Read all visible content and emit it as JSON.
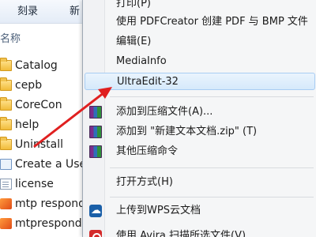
{
  "explorer": {
    "toolbar": {
      "burn_label": "刻录",
      "new_label": "新"
    },
    "column_header": "名称",
    "files": [
      {
        "name": "Catalog",
        "icon": "folder-icon"
      },
      {
        "name": "cepb",
        "icon": "folder-icon"
      },
      {
        "name": "CoreCon",
        "icon": "folder-icon"
      },
      {
        "name": "help",
        "icon": "folder-icon"
      },
      {
        "name": "Uninstall",
        "icon": "folder-icon"
      },
      {
        "name": "Create a User",
        "icon": "shortcut-icon"
      },
      {
        "name": "license",
        "icon": "doc-icon"
      },
      {
        "name": "mtp respond",
        "icon": "app-icon"
      },
      {
        "name": "mtprespond",
        "icon": "app-icon"
      }
    ]
  },
  "context_menu": {
    "items": [
      {
        "label": "打印(P)",
        "icon": ""
      },
      {
        "label": "使用 PDFCreator 创建 PDF 与 BMP 文件",
        "icon": ""
      },
      {
        "label": "编辑(E)",
        "icon": ""
      },
      {
        "label": "MediaInfo",
        "icon": ""
      },
      {
        "label": "UltraEdit-32",
        "icon": "",
        "highlighted": true
      },
      {
        "label": "添加到压缩文件(A)...",
        "icon": "rar-icon"
      },
      {
        "label": "添加到 \"新建文本文档.zip\" (T)",
        "icon": "rar-icon"
      },
      {
        "label": "其他压缩命令",
        "icon": "rar-icon"
      },
      {
        "label": "打开方式(H)",
        "icon": ""
      },
      {
        "label": "上传到WPS云文档",
        "icon": "wps-icon"
      },
      {
        "label": "使用 Avira 扫描所选文件(V)",
        "icon": "avira-icon"
      }
    ]
  },
  "colors": {
    "arrow": "#e02020",
    "highlight_border": "#a8cdf3",
    "menu_bg": "#f5f6f7"
  }
}
